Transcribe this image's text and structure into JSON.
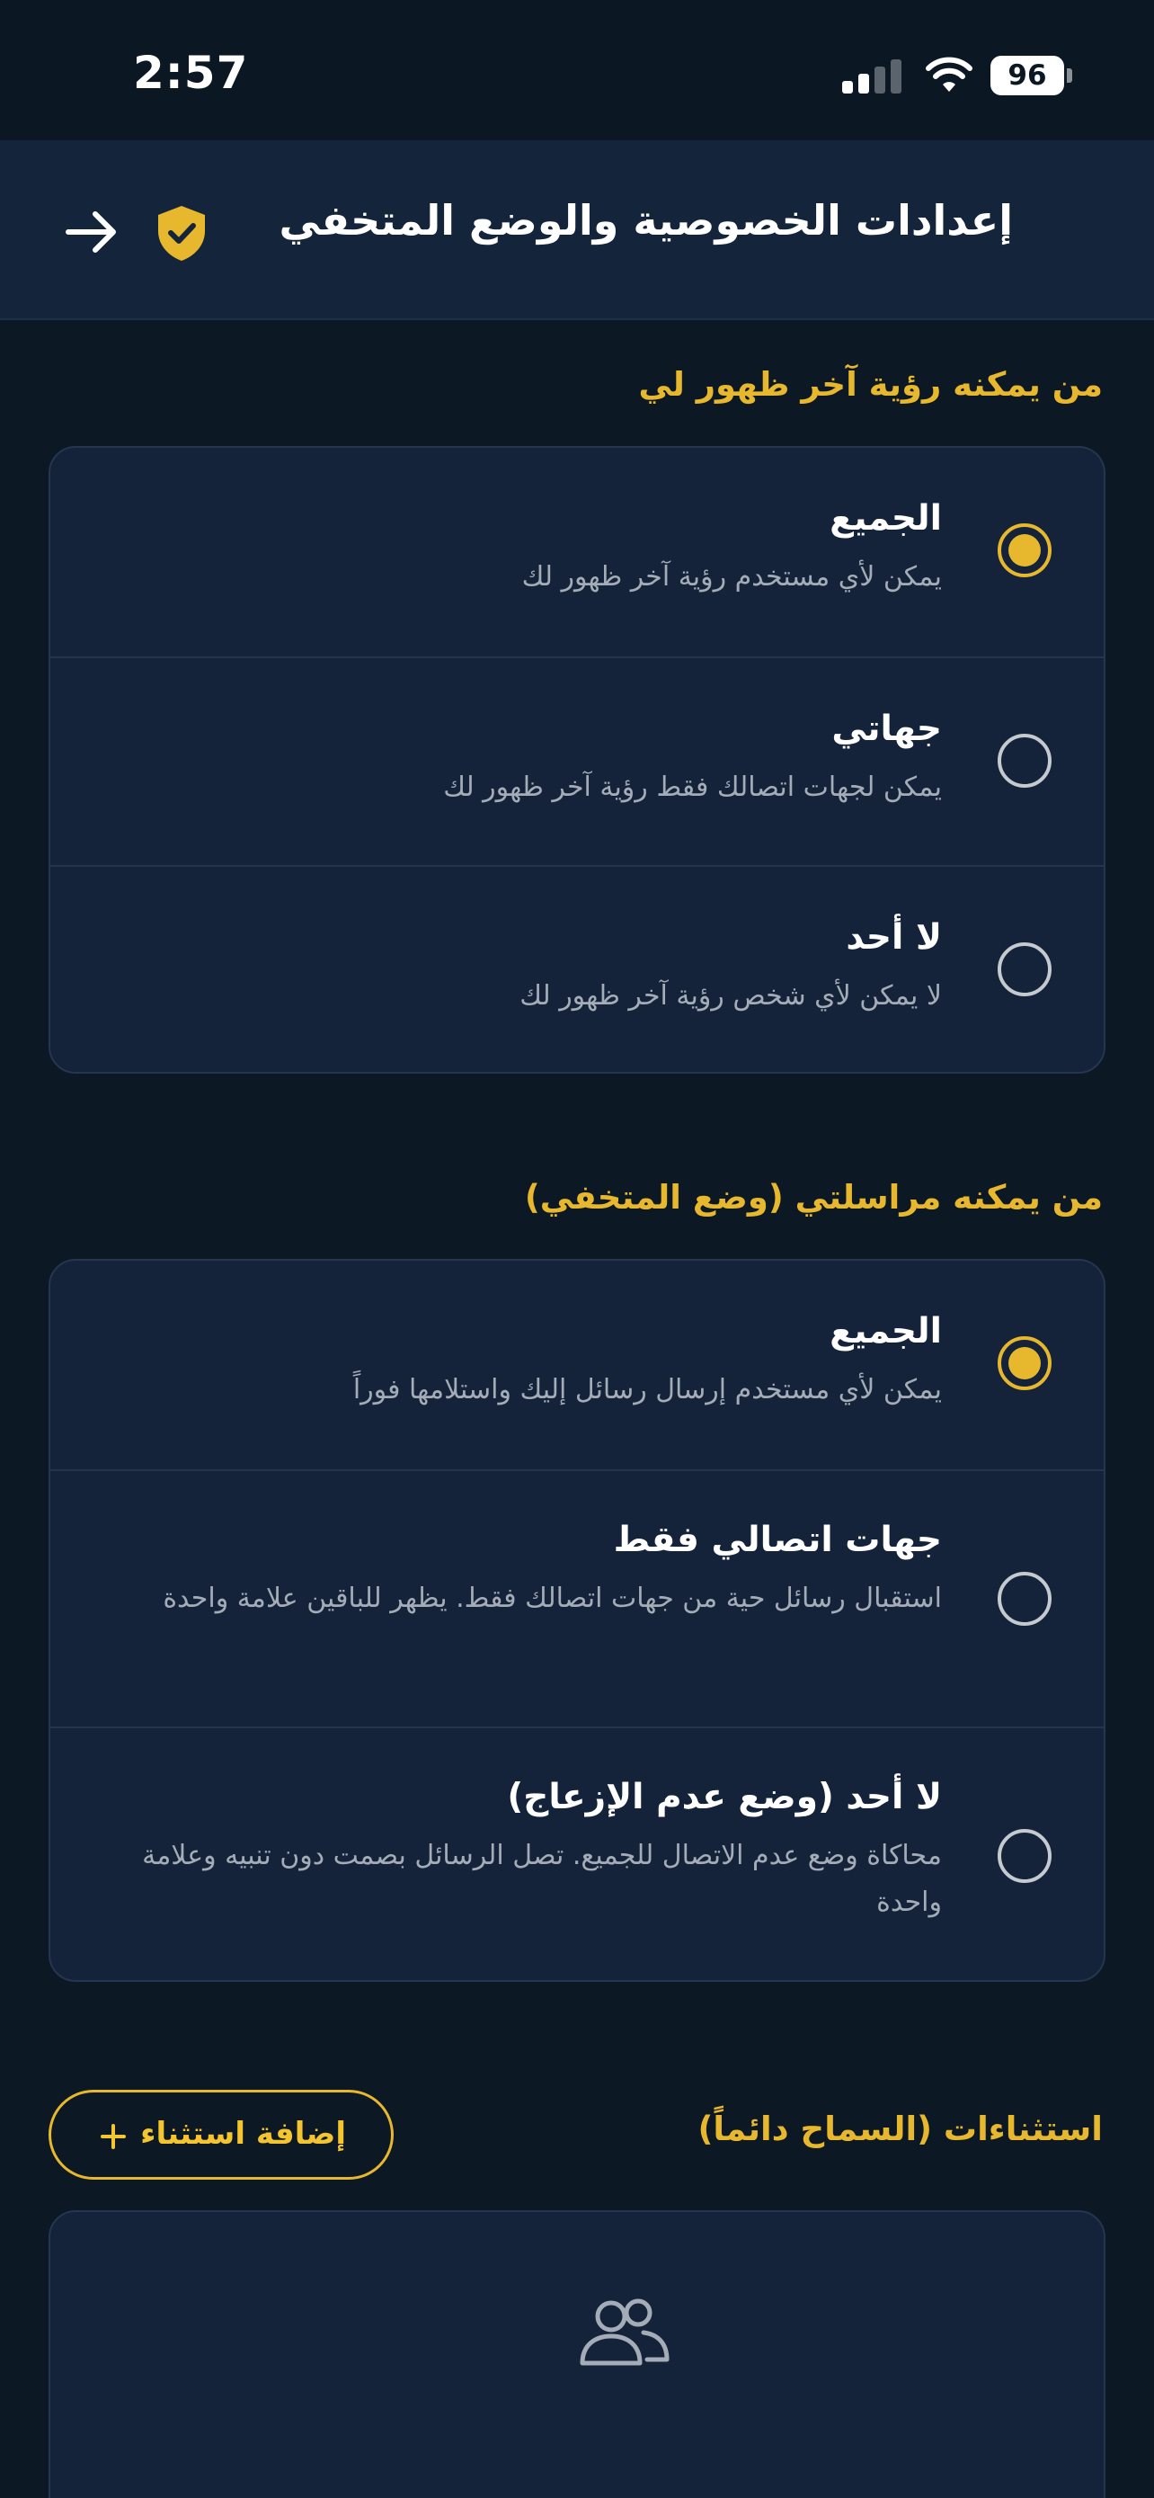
{
  "status_bar": {
    "time": "2:57",
    "battery": "96",
    "signal_icon": "cellular-signal-icon",
    "wifi_icon": "wifi-icon"
  },
  "header": {
    "title": "إعدادات الخصوصية والوضع المتخفي",
    "shield_icon": "shield-check-icon",
    "back_icon": "arrow-right-icon"
  },
  "last_seen": {
    "title": "من يمكنه رؤية آخر ظهور لي",
    "options": [
      {
        "label": "الجميع",
        "description": "يمكن لأي مستخدم رؤية آخر ظهور لك",
        "selected": true
      },
      {
        "label": "جهاتي",
        "description": "يمكن لجهات اتصالك فقط رؤية آخر ظهور لك",
        "selected": false
      },
      {
        "label": "لا أحد",
        "description": "لا يمكن لأي شخص رؤية آخر ظهور لك",
        "selected": false
      }
    ]
  },
  "messaging": {
    "title": "من يمكنه مراسلتي (وضع المتخفي)",
    "options": [
      {
        "label": "الجميع",
        "description": "يمكن لأي مستخدم إرسال رسائل إليك واستلامها فوراً",
        "selected": true
      },
      {
        "label": "جهات اتصالي فقط",
        "description": "استقبال رسائل حية من جهات اتصالك فقط. يظهر للباقين علامة واحدة",
        "selected": false
      },
      {
        "label": "لا أحد (وضع عدم الإزعاج)",
        "description": "محاكاة وضع عدم الاتصال للجميع. تصل الرسائل بصمت دون تنبيه وعلامة واحدة",
        "selected": false
      }
    ]
  },
  "exceptions": {
    "title": "استثناءات (السماح دائماً)",
    "add_button": "إضافة استثناء",
    "empty_icon": "people-icon"
  },
  "colors": {
    "accent": "#e7b72e",
    "background": "#0c1824",
    "card": "#14233a",
    "header": "#14243a"
  }
}
